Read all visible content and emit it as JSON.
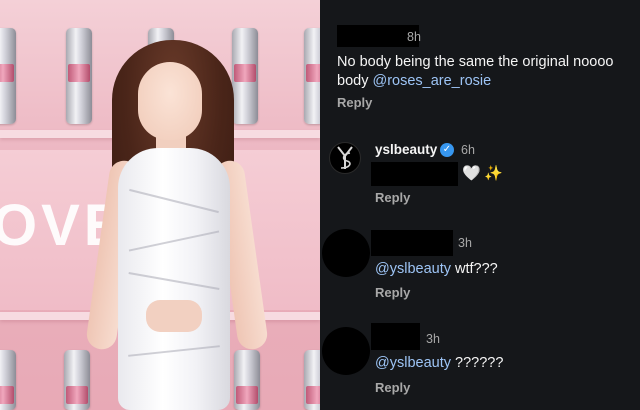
{
  "photo": {
    "banner_text": "OVE   E F",
    "alt_subject": "photo"
  },
  "comments": [
    {
      "time": "8h",
      "text_line1": "No body being the same the original noooo",
      "text_line2": "body ",
      "mention": "@roses_are_rosie",
      "reply_label": "Reply"
    },
    {
      "username": "yslbeauty",
      "time": "6h",
      "emoji1": "🤍",
      "emoji2": "✨",
      "reply_label": "Reply"
    },
    {
      "time": "3h",
      "mention": "@yslbeauty",
      "text": " wtf???",
      "reply_label": "Reply"
    },
    {
      "time": "3h",
      "mention": "@yslbeauty",
      "text": " ??????",
      "reply_label": "Reply"
    }
  ],
  "colors": {
    "background": "#15171a",
    "mention": "#9dc4f5",
    "verified": "#3797f0",
    "secondary_text": "#a8a8a8"
  }
}
